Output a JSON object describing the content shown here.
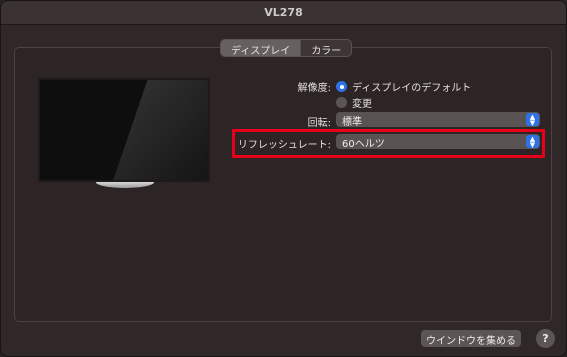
{
  "window": {
    "title": "VL278"
  },
  "tabs": [
    {
      "label": "ディスプレイ",
      "active": true
    },
    {
      "label": "カラー",
      "active": false
    }
  ],
  "resolution": {
    "label": "解像度:",
    "options": [
      {
        "label": "ディスプレイのデフォルト",
        "selected": true
      },
      {
        "label": "変更",
        "selected": false
      }
    ]
  },
  "rotation": {
    "label": "回転:",
    "value": "標準"
  },
  "refresh_rate": {
    "label": "リフレッシュレート:",
    "value": "60ヘルツ"
  },
  "footer": {
    "gather_windows_label": "ウインドウを集める",
    "help_label": "?"
  },
  "colors": {
    "accent": "#2f72e8",
    "highlight": "#e8001a"
  }
}
